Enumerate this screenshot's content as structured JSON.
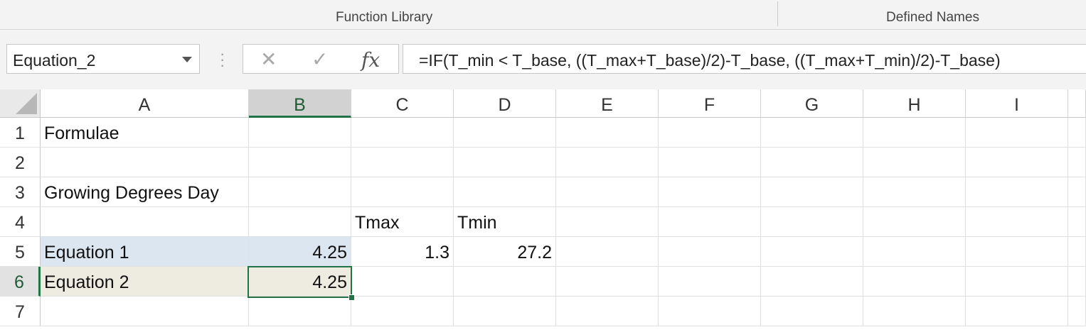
{
  "ribbon": {
    "groups": [
      "Function Library",
      "Defined Names"
    ]
  },
  "formula_bar": {
    "name_box": "Equation_2",
    "cancel_icon": "✕",
    "enter_icon": "✓",
    "fx_label": "fx",
    "formula": "=IF(T_min < T_base, ((T_max+T_base)/2)-T_base, ((T_max+T_min)/2)-T_base)"
  },
  "sheet": {
    "columns": [
      "A",
      "B",
      "C",
      "D",
      "E",
      "F",
      "G",
      "H",
      "I"
    ],
    "rows": [
      "1",
      "2",
      "3",
      "4",
      "5",
      "6",
      "7"
    ],
    "active_cell": "B6",
    "cells": {
      "A1": "Formulae",
      "A3": "Growing Degrees Day",
      "C4": "Tmax",
      "D4": "Tmin",
      "A5": "Equation 1",
      "B5": "4.25",
      "C5": "1.3",
      "D5": "27.2",
      "A6": "Equation 2",
      "B6": "4.25"
    },
    "colors": {
      "accent": "#217346",
      "row5_highlight": "#dce6f1",
      "row6_highlight": "#eeece1"
    }
  }
}
